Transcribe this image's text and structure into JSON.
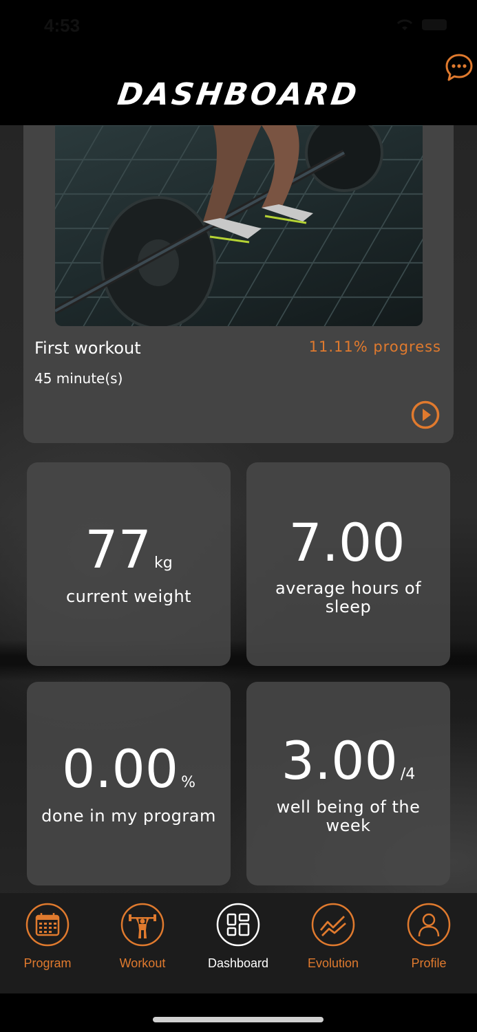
{
  "status_bar": {
    "time": "4:53"
  },
  "header": {
    "title": "DASHBOARD"
  },
  "colors": {
    "accent": "#e07a2e",
    "card": "#474747",
    "background": "#1d1d1d"
  },
  "workout": {
    "name": "First workout",
    "duration": "45 minute(s)",
    "progress": "11.11% progress"
  },
  "stats": [
    {
      "value": "77",
      "unit": "kg",
      "label": "current weight"
    },
    {
      "value": "7.00",
      "unit": "",
      "label": "average hours of sleep"
    },
    {
      "value": "0.00",
      "unit": "%",
      "label": "done in my program"
    },
    {
      "value": "3.00",
      "unit": "/4",
      "label": "well being of the week"
    }
  ],
  "tabs": [
    {
      "label": "Program",
      "icon": "calendar-icon"
    },
    {
      "label": "Workout",
      "icon": "weightlifter-icon"
    },
    {
      "label": "Dashboard",
      "icon": "dashboard-grid-icon",
      "active": true
    },
    {
      "label": "Evolution",
      "icon": "trend-chart-icon"
    },
    {
      "label": "Profile",
      "icon": "user-icon"
    }
  ]
}
